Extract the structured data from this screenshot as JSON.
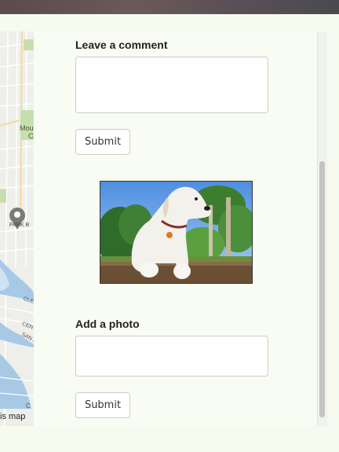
{
  "comment_section": {
    "heading": "Leave a comment",
    "submit_label": "Submit"
  },
  "photo_section": {
    "heading": "Add a photo",
    "submit_label": "Submit"
  },
  "map": {
    "labels": [
      "Mou",
      "C",
      "PARK B",
      "CLEMENT",
      "CENTRAL",
      "SAN JOSE AV",
      "C"
    ],
    "footer": "is map"
  },
  "colors": {
    "page_bg": "#f7fbef",
    "water": "#a7c9e6",
    "park": "#c7dfb0"
  },
  "icons": {
    "map_pin": "dog-pin-icon"
  }
}
